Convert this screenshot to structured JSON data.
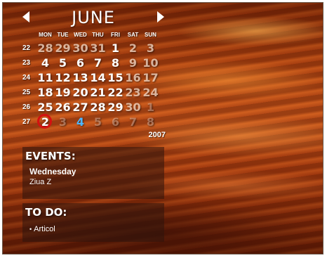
{
  "calendar": {
    "month": "JUNE",
    "year": "2007",
    "weekdays": [
      "MON",
      "TUE",
      "WED",
      "THU",
      "FRI",
      "SAT",
      "SUN"
    ],
    "weeks": [
      {
        "number": "22",
        "days": [
          {
            "d": "28",
            "style": "dim"
          },
          {
            "d": "29",
            "style": "dim"
          },
          {
            "d": "30",
            "style": "dim"
          },
          {
            "d": "31",
            "style": "dim"
          },
          {
            "d": "1",
            "style": "normal"
          },
          {
            "d": "2",
            "style": "dim"
          },
          {
            "d": "3",
            "style": "dim"
          }
        ]
      },
      {
        "number": "23",
        "days": [
          {
            "d": "4",
            "style": "normal"
          },
          {
            "d": "5",
            "style": "normal"
          },
          {
            "d": "6",
            "style": "normal"
          },
          {
            "d": "7",
            "style": "normal"
          },
          {
            "d": "8",
            "style": "normal"
          },
          {
            "d": "9",
            "style": "dim"
          },
          {
            "d": "10",
            "style": "dim"
          }
        ]
      },
      {
        "number": "24",
        "days": [
          {
            "d": "11",
            "style": "normal"
          },
          {
            "d": "12",
            "style": "normal"
          },
          {
            "d": "13",
            "style": "normal"
          },
          {
            "d": "14",
            "style": "normal"
          },
          {
            "d": "15",
            "style": "normal"
          },
          {
            "d": "16",
            "style": "dim"
          },
          {
            "d": "17",
            "style": "dim"
          }
        ]
      },
      {
        "number": "25",
        "days": [
          {
            "d": "18",
            "style": "normal"
          },
          {
            "d": "19",
            "style": "normal"
          },
          {
            "d": "20",
            "style": "normal"
          },
          {
            "d": "21",
            "style": "normal"
          },
          {
            "d": "22",
            "style": "normal"
          },
          {
            "d": "23",
            "style": "dim"
          },
          {
            "d": "24",
            "style": "dim"
          }
        ]
      },
      {
        "number": "26",
        "days": [
          {
            "d": "25",
            "style": "normal"
          },
          {
            "d": "26",
            "style": "normal"
          },
          {
            "d": "27",
            "style": "normal"
          },
          {
            "d": "28",
            "style": "normal"
          },
          {
            "d": "29",
            "style": "normal"
          },
          {
            "d": "30",
            "style": "dim"
          },
          {
            "d": "1",
            "style": "faint"
          }
        ]
      },
      {
        "number": "27",
        "days": [
          {
            "d": "2",
            "style": "today"
          },
          {
            "d": "3",
            "style": "faint"
          },
          {
            "d": "4",
            "style": "blue"
          },
          {
            "d": "5",
            "style": "faint"
          },
          {
            "d": "6",
            "style": "faint"
          },
          {
            "d": "7",
            "style": "faint"
          },
          {
            "d": "8",
            "style": "faint"
          }
        ]
      }
    ]
  },
  "events": {
    "title": "EVENTS:",
    "day": "Wednesday",
    "text": "Ziua Z"
  },
  "todo": {
    "title": "TO DO:",
    "bullet": "•",
    "items": [
      "Articol"
    ]
  },
  "colors": {
    "today_ring": "#d41111",
    "highlight_day": "#4fb6ff"
  }
}
